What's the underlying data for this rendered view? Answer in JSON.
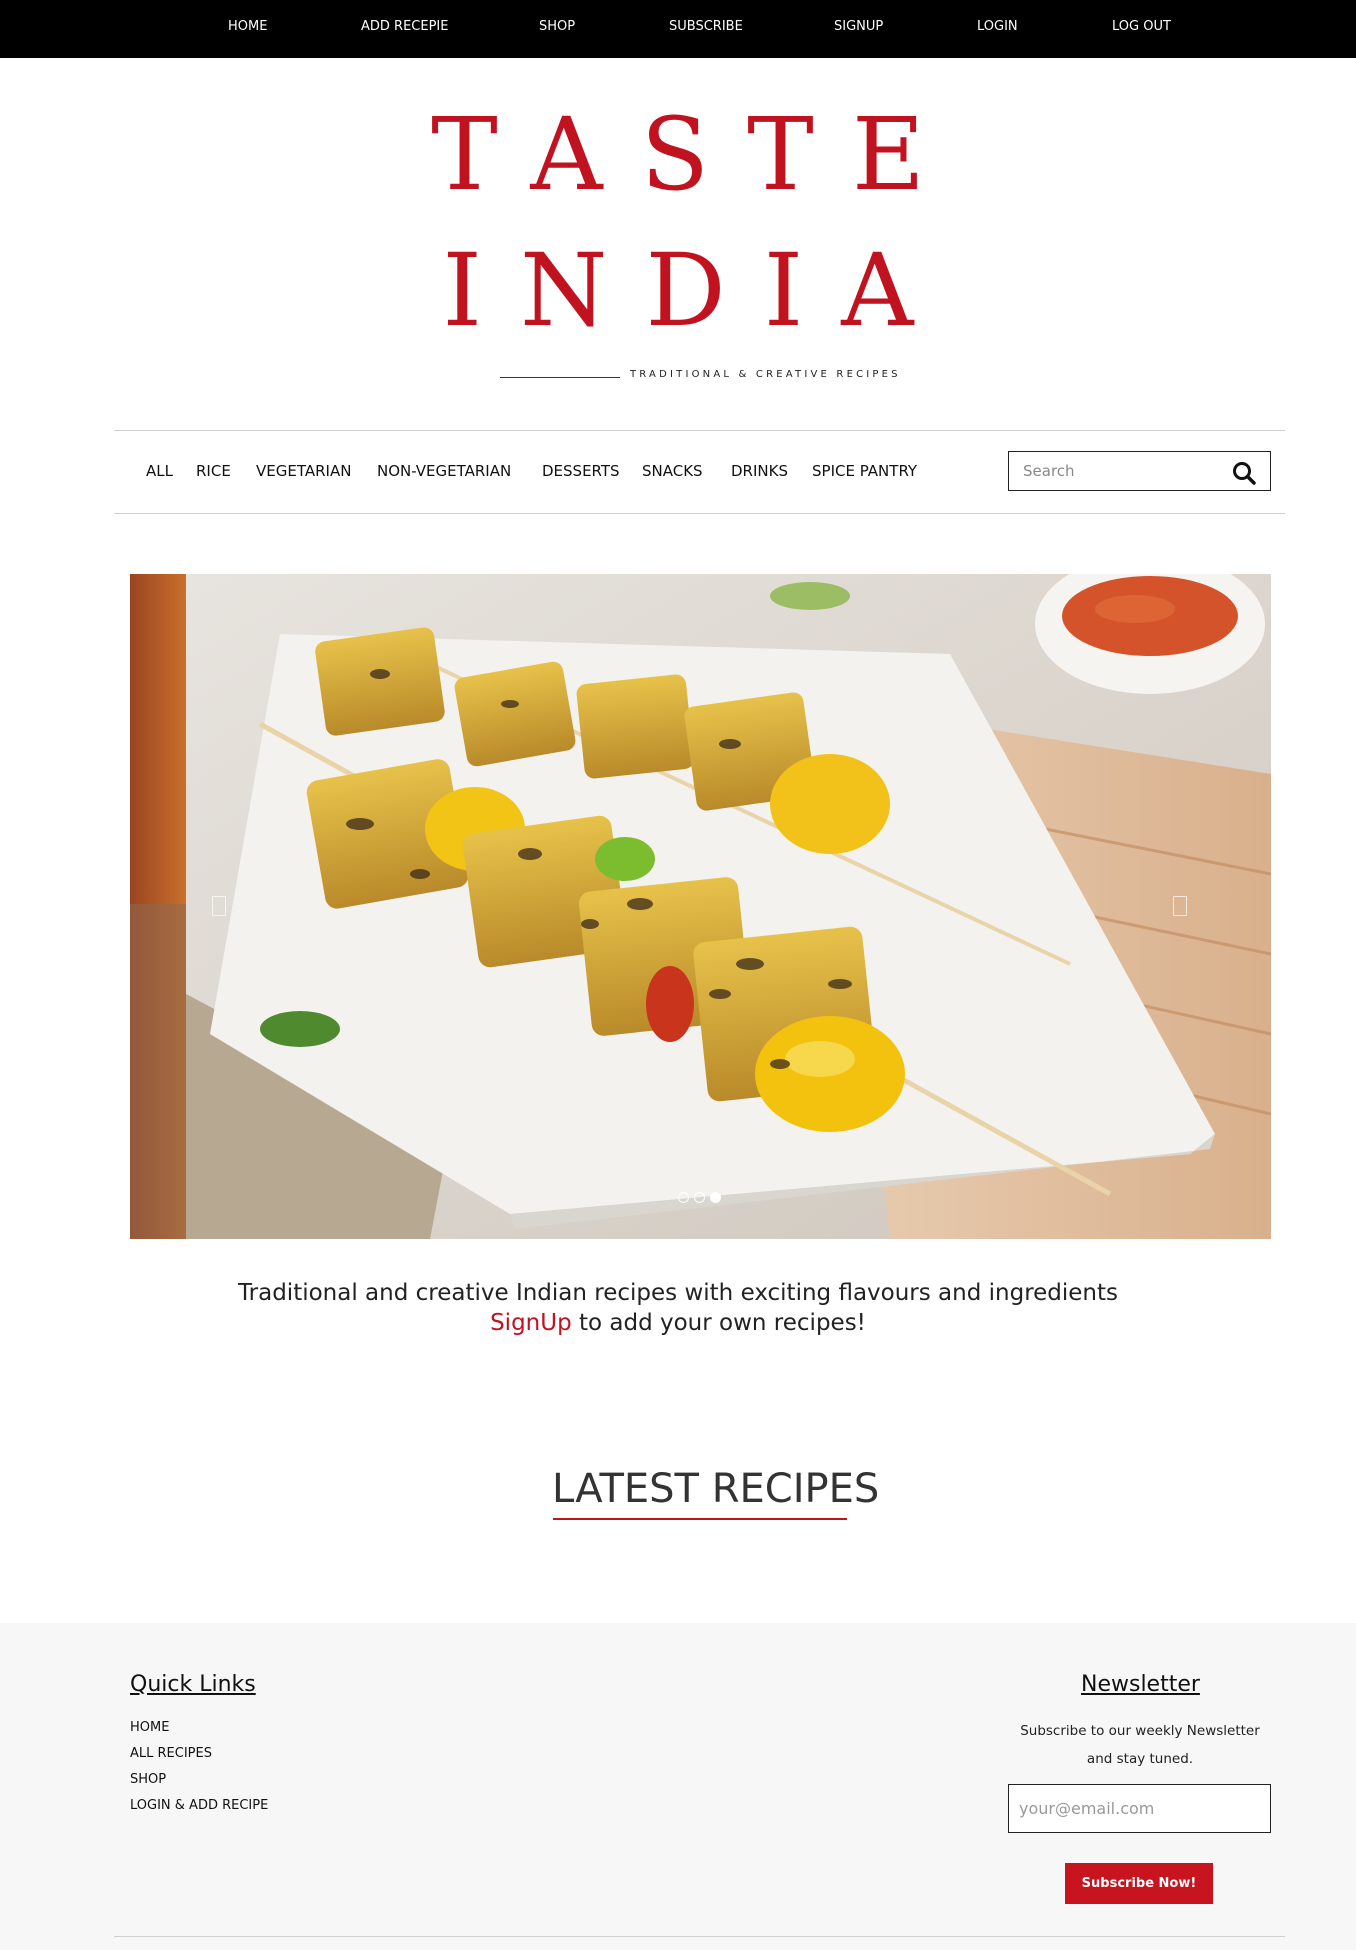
{
  "top_nav": {
    "items": [
      "HOME",
      "ADD RECEPIE",
      "SHOP",
      "SUBSCRIBE",
      "SIGNUP",
      "LOGIN",
      "LOG OUT"
    ]
  },
  "brand": {
    "line1": "TASTE",
    "line2": "INDIA",
    "tagline": "TRADITIONAL & CREATIVE RECIPES",
    "color": "#c1121f"
  },
  "categories": [
    "ALL",
    "RICE",
    "VEGETARIAN",
    "NON-VEGETARIAN",
    "DESSERTS",
    "SNACKS",
    "DRINKS",
    "SPICE PANTRY"
  ],
  "search": {
    "placeholder": "Search",
    "icon": "search-icon"
  },
  "hero": {
    "slide_count": 3,
    "active_slide": 3
  },
  "intro": {
    "line1": "Traditional and creative Indian recipes with exciting flavours and ingredients",
    "signup_link": "SignUp",
    "line2_rest": " to add your own recipes!"
  },
  "latest_recipes": {
    "heading": "LATEST RECIPES"
  },
  "footer": {
    "quick_links_title": "Quick Links",
    "quick_links": [
      "HOME",
      "ALL RECIPES",
      "SHOP",
      "LOGIN & ADD RECIPE"
    ],
    "newsletter_title": "Newsletter",
    "newsletter_text1": "Subscribe to our weekly Newsletter",
    "newsletter_text2": "and stay tuned.",
    "email_placeholder": "your@email.com",
    "subscribe_label": "Subscribe Now!"
  }
}
